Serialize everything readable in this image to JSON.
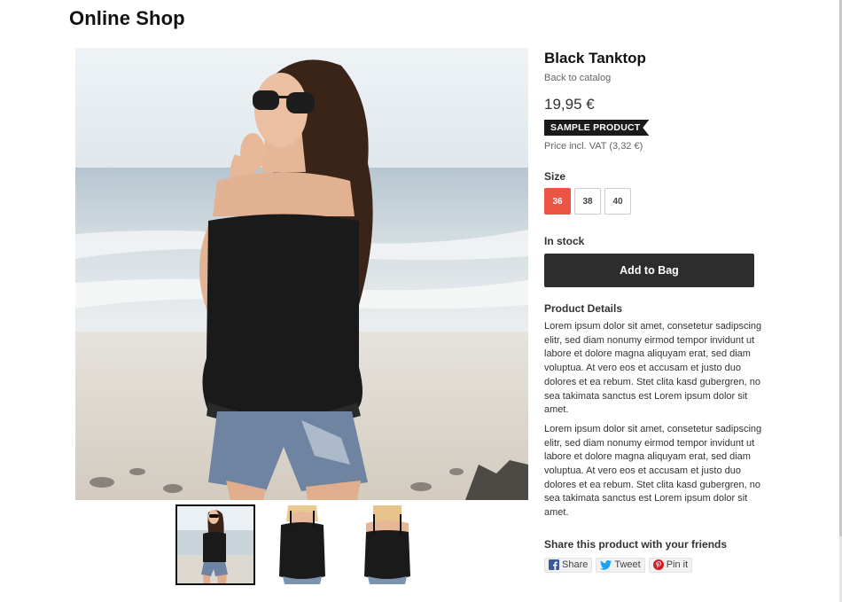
{
  "header": {
    "shop_title": "Online Shop"
  },
  "product": {
    "title": "Black Tanktop",
    "back_link": "Back to catalog",
    "price": "19,95 €",
    "badge": "SAMPLE PRODUCT",
    "vat_note": "Price incl. VAT (3,32 €)",
    "size_label": "Size",
    "sizes": [
      "36",
      "38",
      "40"
    ],
    "selected_size": "36",
    "stock_status": "In stock",
    "add_to_bag": "Add to Bag",
    "details_label": "Product Details",
    "description": [
      "Lorem ipsum dolor sit amet, consetetur sadipscing elitr, sed diam nonumy eirmod tempor invidunt ut labore et dolore magna aliquyam erat, sed diam voluptua. At vero eos et accusam et justo duo dolores et ea rebum. Stet clita kasd gubergren, no sea takimata sanctus est Lorem ipsum dolor sit amet.",
      "Lorem ipsum dolor sit amet, consetetur sadipscing elitr, sed diam nonumy eirmod tempor invidunt ut labore et dolore magna aliquyam erat, sed diam voluptua. At vero eos et accusam et justo duo dolores et ea rebum. Stet clita kasd gubergren, no sea takimata sanctus est Lorem ipsum dolor sit amet."
    ]
  },
  "share": {
    "label": "Share this product with your friends",
    "buttons": [
      {
        "label": "Share",
        "icon": "facebook-icon",
        "color": "#3b5998"
      },
      {
        "label": "Tweet",
        "icon": "twitter-icon",
        "color": "#1da1f2"
      },
      {
        "label": "Pin it",
        "icon": "pinterest-icon",
        "color": "#cb2027"
      }
    ]
  },
  "gallery": {
    "images": [
      "product-photo-beach",
      "product-photo-front",
      "product-photo-back"
    ],
    "active_index": 0
  },
  "colors": {
    "accent": "#ec5444",
    "button_dark": "#2d2d2d",
    "badge_bg": "#1b1b1b"
  }
}
